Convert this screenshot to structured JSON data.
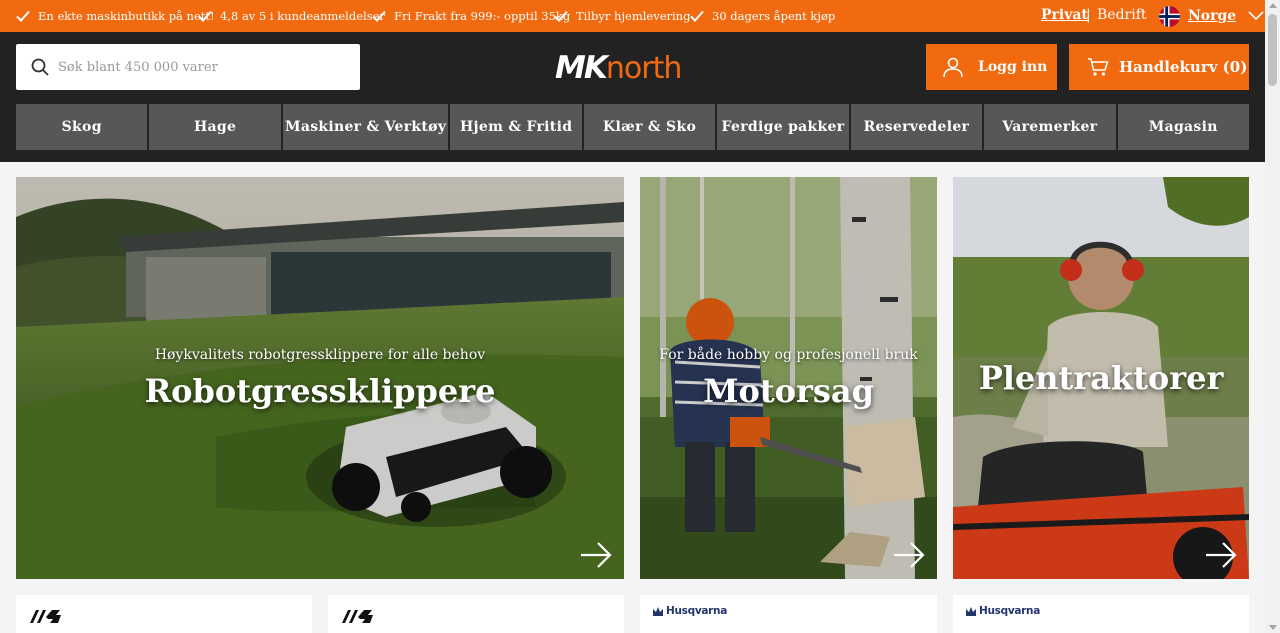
{
  "usp_bar": {
    "items": [
      "En ekte maskinbutikk på nett!",
      "4,8 av 5 i kundeanmeldelser",
      "Fri Frakt fra 999:- opptil 35kg",
      "Tilbyr hjemlevering",
      "30 dagers åpent kjøp"
    ],
    "segment_privat": "Privat",
    "segment_separator": "|",
    "segment_bedrift": "Bedrift",
    "country": "Norge"
  },
  "header": {
    "search_placeholder": "Søk blant 450 000 varer",
    "logo_mk": "MK",
    "logo_north": "north",
    "login_label": "Logg inn",
    "cart_label": "Handlekurv (0)"
  },
  "nav": {
    "items": [
      "Skog",
      "Hage",
      "Maskiner & Verktøy",
      "Hjem & Fritid",
      "Klær & Sko",
      "Ferdige pakker",
      "Reservedeler",
      "Varemerker",
      "Magasin"
    ]
  },
  "hero": {
    "tiles": [
      {
        "subtitle": "Høykvalitets robotgressklippere for alle behov",
        "title": "Robotgressklippere"
      },
      {
        "subtitle": "For både hobby og profesjonell bruk",
        "title": "Motorsag"
      },
      {
        "subtitle": "",
        "title": "Plentraktorer"
      }
    ]
  },
  "cards": {
    "brands": [
      "Husqvarna",
      "Husqvarna"
    ]
  },
  "colors": {
    "accent": "#f26a10",
    "header_bg": "#222222",
    "nav_bg": "#575757"
  }
}
